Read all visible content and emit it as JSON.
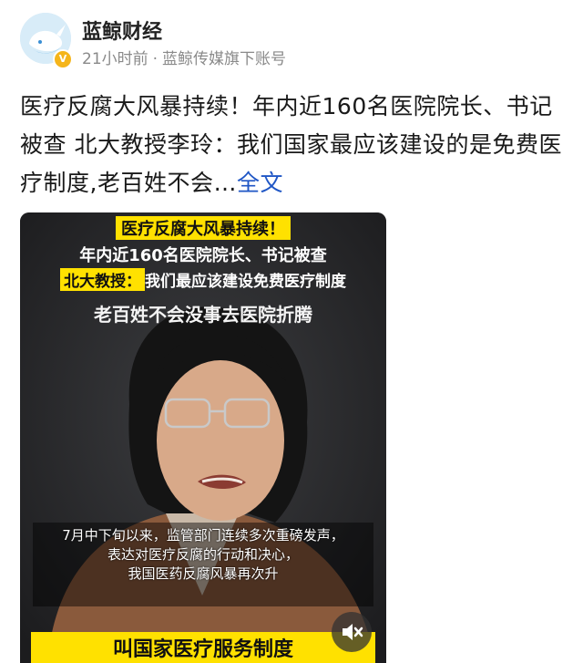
{
  "account": {
    "name": "蓝鲸财经",
    "time": "21小时前",
    "separator": "·",
    "subtitle": "蓝鲸传媒旗下账号",
    "verified_icon": "verified-badge-icon"
  },
  "post": {
    "text": "医疗反腐大风暴持续！年内近160名医院院长、书记被查 北大教授李玲：我们国家最应该建设的是免费医疗制度,老百姓不会…",
    "more_label": "全文"
  },
  "video": {
    "caption_line1": "医疗反腐大风暴持续！",
    "caption_line2": "年内近160名医院院长、书记被查",
    "caption_line3_highlight": "北大教授：",
    "caption_line3_rest": "我们最应该建设免费医疗制度",
    "caption_line4": "老百姓不会没事去医院折腾",
    "subtitle_line1": "7月中下旬以来，监管部门连续多次重磅发声，",
    "subtitle_line2": "表达对医疗反腐的行动和决心，",
    "subtitle_line3": "我国医药反腐风暴再次升",
    "bottom_banner": "叫国家医疗服务制度",
    "mute_icon": "speaker-muted-icon"
  },
  "colors": {
    "link": "#1f56c5",
    "caption_yellow": "#ffe100",
    "meta_gray": "#8a8a8a"
  }
}
